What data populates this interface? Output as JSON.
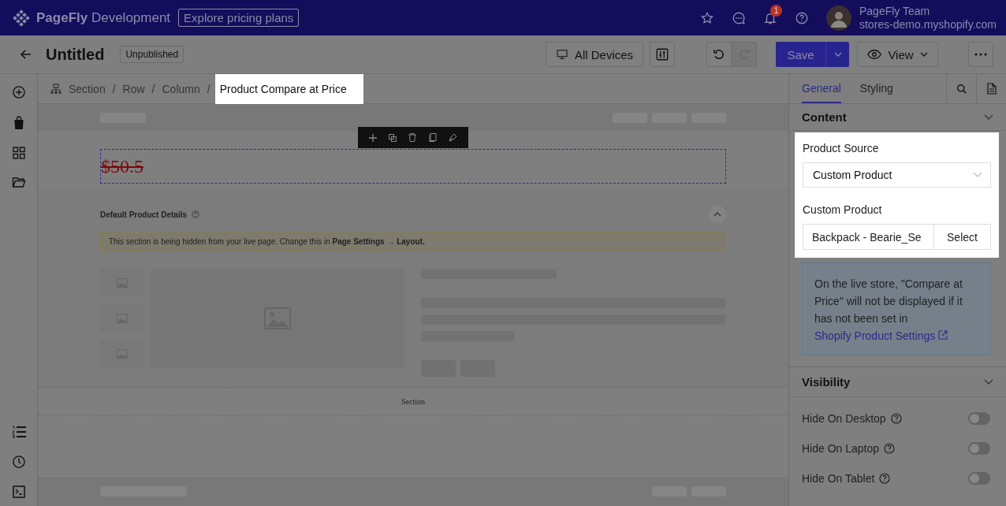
{
  "topbar": {
    "brand": "PageFly",
    "brand_suffix": "Development",
    "pricing_link": "Explore pricing plans",
    "notification_count": "1",
    "user_name": "PageFly Team",
    "store": "stores-demo.myshopify.com"
  },
  "toolbar": {
    "title": "Untitled",
    "status": "Unpublished",
    "device": "All Devices",
    "save": "Save",
    "view": "View"
  },
  "breadcrumb": [
    {
      "label": "Section",
      "selected": false
    },
    {
      "label": "Row",
      "selected": false,
      "separator_before": "/"
    },
    {
      "label": "Column",
      "selected": false,
      "separator_before": "/"
    },
    {
      "label": "Product Compare at Price",
      "selected": true,
      "separator_before": "/"
    }
  ],
  "canvas": {
    "price": "$50.5",
    "details_title": "Default Product Details",
    "notice": "This section is being hidden from your live page. Change this in **Page Settings → Layout.**",
    "section_label": "Section"
  },
  "panel": {
    "tabs": [
      {
        "label": "General",
        "selected": true
      },
      {
        "label": "Styling",
        "selected": false
      }
    ],
    "content_heading": "Content",
    "source_label": "Product Source",
    "source_value": "Custom Product",
    "custom_label": "Custom Product",
    "custom_value": "Backpack - Bearie_Se",
    "select_button": "Select",
    "info_text": "On the live store, \"Compare at Price\" will not be displayed if it has not been set in",
    "info_link": "Shopify Product Settings",
    "visibility_heading": "Visibility",
    "toggles": [
      {
        "label": "Hide On Desktop",
        "on": false
      },
      {
        "label": "Hide On Laptop",
        "on": false
      },
      {
        "label": "Hide On Tablet",
        "on": false
      }
    ]
  }
}
